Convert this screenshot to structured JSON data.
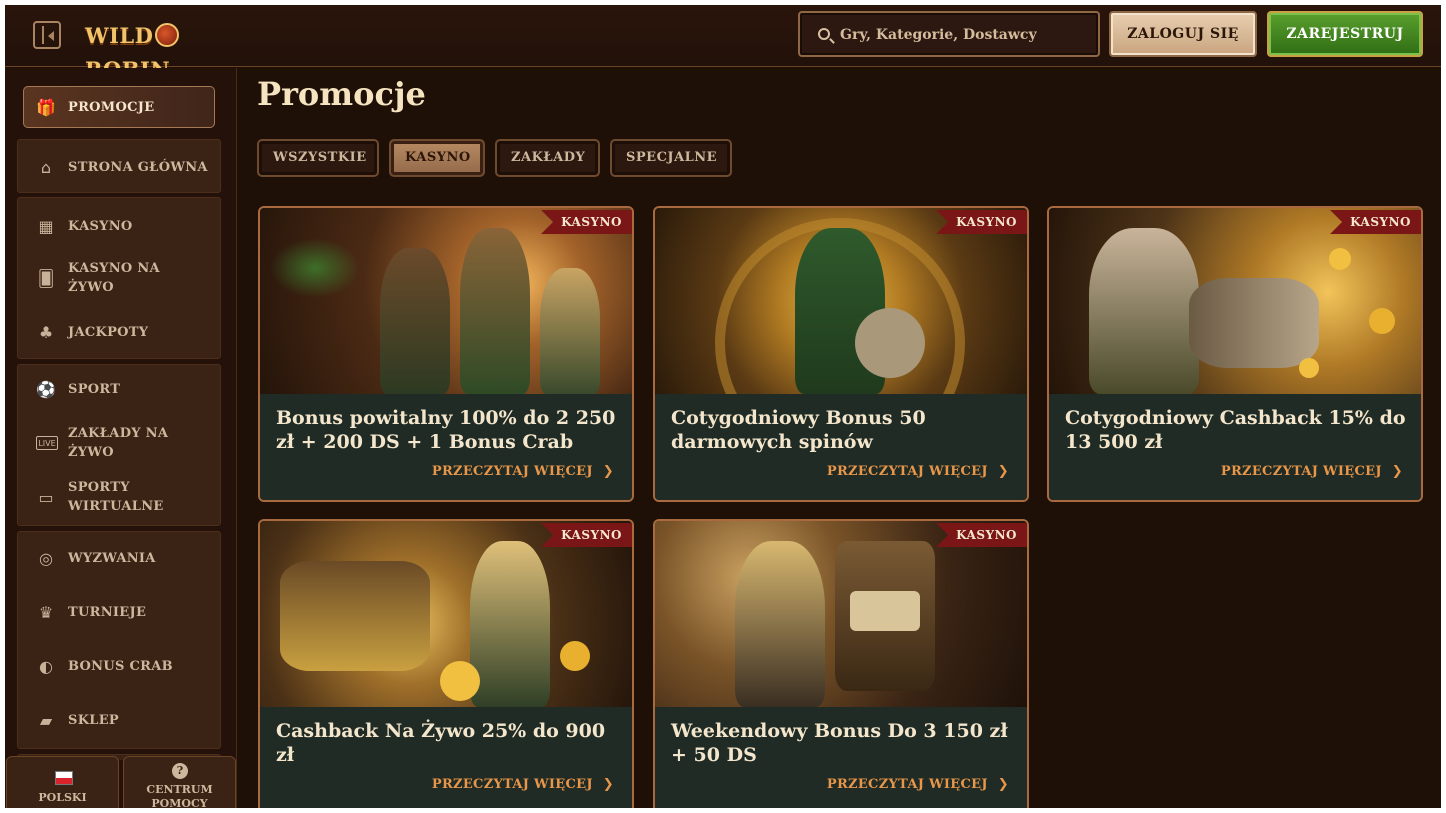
{
  "header": {
    "logo_text_left": "WILD",
    "logo_text_right": "ROBIN",
    "search_placeholder": "Gry, Kategorie, Dostawcy",
    "login_label": "ZALOGUJ SIĘ",
    "register_label": "ZAREJESTRUJ"
  },
  "sidebar": {
    "promo": "PROMOCJE",
    "home": "STRONA GŁÓWNA",
    "casino": "KASYNO",
    "live_casino": "KASYNO NA ŻYWO",
    "jackpots": "JACKPOTY",
    "sport": "SPORT",
    "live_bets": "ZAKŁADY NA ŻYWO",
    "virtual_sports": "SPORTY WIRTUALNE",
    "challenges": "WYZWANIA",
    "tournaments": "TURNIEJE",
    "bonus_crab": "BONUS CRAB",
    "shop": "SKLEP",
    "language": "POLSKI",
    "help": "CENTRUM POMOCY",
    "live_badge": "LIVE"
  },
  "main": {
    "title": "Promocje",
    "tabs": [
      "WSZYSTKIE",
      "KASYNO",
      "ZAKŁADY",
      "SPECJALNE"
    ],
    "active_tab": "KASYNO",
    "read_more": "PRZECZYTAJ WIĘCEJ",
    "cards": [
      {
        "badge": "KASYNO",
        "title": "Bonus powitalny 100% do 2 250 zł + 200 DS + 1 Bonus Crab"
      },
      {
        "badge": "KASYNO",
        "title": "Cotygodniowy Bonus 50 darmowych spinów"
      },
      {
        "badge": "KASYNO",
        "title": "Cotygodniowy Cashback 15% do 13 500 zł"
      },
      {
        "badge": "KASYNO",
        "title": "Cashback Na Żywo 25% do 900 zł"
      },
      {
        "badge": "KASYNO",
        "title": "Weekendowy Bonus Do 3 150 zł + 50 DS"
      }
    ]
  },
  "colors": {
    "background": "#1e0f07",
    "accent_orange": "#e8964a",
    "register_green": "#3f8a1e",
    "badge_red": "#7a1616"
  }
}
